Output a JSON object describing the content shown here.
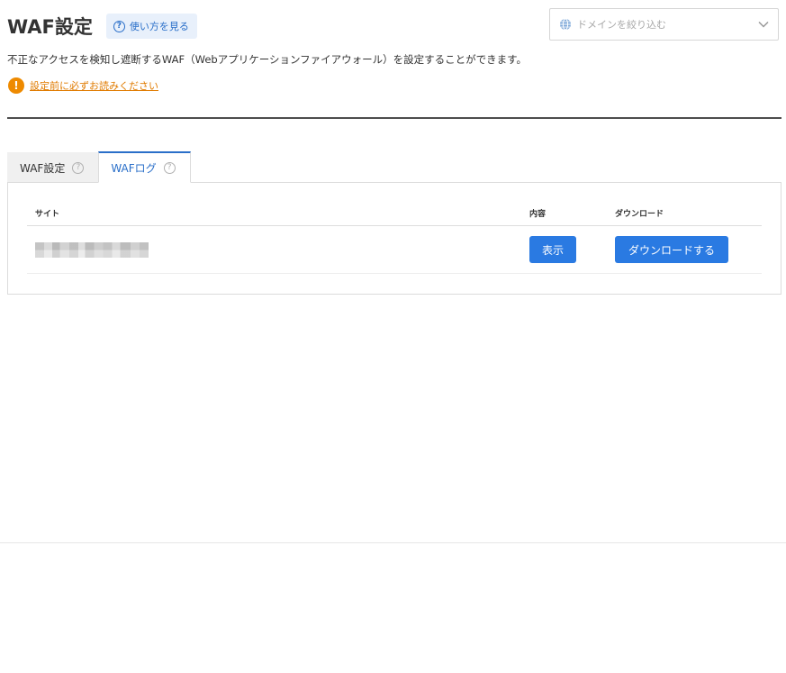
{
  "header": {
    "title": "WAF設定",
    "help_button_label": "使い方を見る",
    "help_icon_glyph": "?"
  },
  "domain_filter": {
    "placeholder": "ドメインを絞り込む",
    "icon": "globe-icon"
  },
  "description": "不正なアクセスを検知し遮断するWAF（Webアプリケーションファイアウォール）を設定することができます。",
  "notice": {
    "icon_glyph": "!",
    "link_text": "設定前に必ずお読みください",
    "color": "#e07b00"
  },
  "tabs": [
    {
      "label": "WAF設定",
      "active": false
    },
    {
      "label": "WAFログ",
      "active": true
    }
  ],
  "tab_help_glyph": "?",
  "table": {
    "columns": {
      "site": "サイト",
      "content": "内容",
      "download": "ダウンロード"
    },
    "rows": [
      {
        "site": "",
        "view_label": "表示",
        "download_label": "ダウンロードする"
      }
    ]
  },
  "colors": {
    "accent": "#2a7ae2",
    "link_blue": "#2a6fc9",
    "warning": "#ee8a00"
  }
}
